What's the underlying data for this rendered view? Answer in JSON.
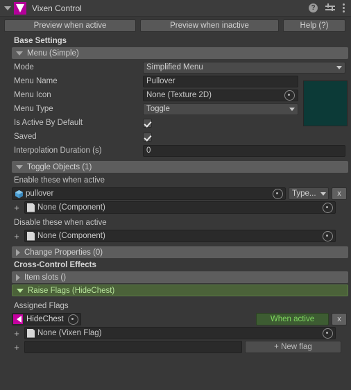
{
  "window": {
    "title": "Vixen Control",
    "logo_icon": "vixen-logo",
    "help_icon": "help-icon",
    "preset_icon": "preset-icon",
    "menu_icon": "kebab-menu-icon"
  },
  "toolbar": {
    "preview_active_label": "Preview when active",
    "preview_inactive_label": "Preview when inactive",
    "help_label": "Help (?)"
  },
  "base_settings": {
    "heading": "Base Settings",
    "menu_foldout_label": "Menu (Simple)",
    "mode_label": "Mode",
    "mode_value": "Simplified Menu",
    "menu_name_label": "Menu Name",
    "menu_name_value": "Pullover",
    "menu_icon_label": "Menu Icon",
    "menu_icon_value": "None (Texture 2D)",
    "menu_type_label": "Menu Type",
    "menu_type_value": "Toggle",
    "is_active_label": "Is Active By Default",
    "is_active_checked": "on",
    "saved_label": "Saved",
    "saved_checked": "on",
    "interpolation_label": "Interpolation Duration (s)",
    "interpolation_value": "0",
    "preview_swatch_color": "#0c3a37"
  },
  "toggle_objects": {
    "foldout_label": "Toggle Objects (1)",
    "enable_label": "Enable these when active",
    "enable_entry": "pullover",
    "enable_entry_icon": "gameobject-cube-icon",
    "type_button_label": "Type...",
    "remove_label": "x",
    "enable_add_row": "None (Component)",
    "disable_label": "Disable these when active",
    "disable_add_row": "None (Component)",
    "add_symbol": "+"
  },
  "change_properties": {
    "foldout_label": "Change Properties (0)"
  },
  "cross_control": {
    "heading": "Cross-Control Effects",
    "item_slots_label": "Item slots ()",
    "raise_flags_label": "Raise Flags (HideChest)",
    "raise_flags_color": "#4b6239"
  },
  "assigned_flags": {
    "heading": "Assigned Flags",
    "flag_name": "HideChest",
    "flag_icon": "vixen-flag-icon",
    "when_active_label": "When active",
    "when_active_color": "#3d5c32",
    "remove_label": "x",
    "add_row_value": "None (Vixen Flag)",
    "new_flag_label": "+ New flag",
    "new_flag_input_value": "",
    "add_symbol": "+"
  }
}
